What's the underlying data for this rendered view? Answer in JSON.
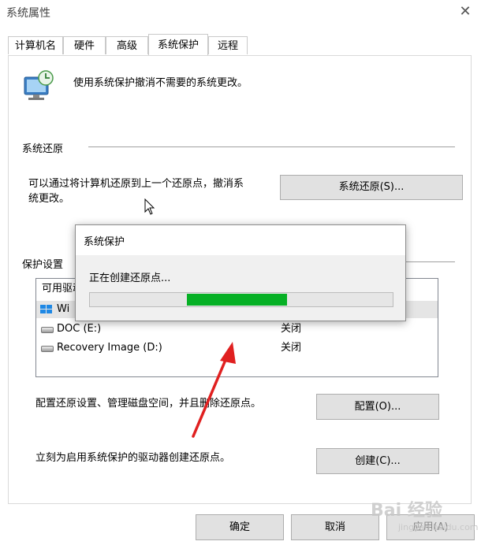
{
  "window": {
    "title": "系统属性",
    "close_glyph": "✕"
  },
  "tabs": [
    {
      "label": "计算机名",
      "active": false
    },
    {
      "label": "硬件",
      "active": false
    },
    {
      "label": "高级",
      "active": false
    },
    {
      "label": "系统保护",
      "active": true
    },
    {
      "label": "远程",
      "active": false
    }
  ],
  "intro": {
    "icon": "system-protection-icon",
    "text": "使用系统保护撤消不需要的系统更改。"
  },
  "restore": {
    "heading": "系统还原",
    "desc_line1": "可以通过将计算机还原到上一个还原点，撤消系",
    "desc_line2": "统更改。",
    "button": "系统还原(S)..."
  },
  "protection": {
    "heading": "保护设置",
    "list_header": "可用驱动器",
    "drives": [
      {
        "name": "Wi",
        "status": "",
        "icon": "windows-drive-icon"
      },
      {
        "name": "DOC (E:)",
        "status": "关闭",
        "icon": "hard-drive-icon"
      },
      {
        "name": "Recovery Image (D:)",
        "status": "关闭",
        "icon": "hard-drive-icon"
      }
    ],
    "configure_text": "配置还原设置、管理磁盘空间，并且删除还原点。",
    "configure_button": "配置(O)...",
    "create_text": "立刻为启用系统保护的驱动器创建还原点。",
    "create_button": "创建(C)..."
  },
  "footer": {
    "ok": "确定",
    "cancel": "取消",
    "apply": "应用(A)"
  },
  "progress_dialog": {
    "title": "系统保护",
    "message": "正在创建还原点...",
    "progress_segment_start": 0.32,
    "progress_segment_end": 0.65,
    "fill_color": "#06b025"
  },
  "watermark": {
    "text": "Bai 经验",
    "sub": "jingyan.baidu.com"
  },
  "colors": {
    "arrow": "#e02020",
    "accent": "#06b025"
  }
}
